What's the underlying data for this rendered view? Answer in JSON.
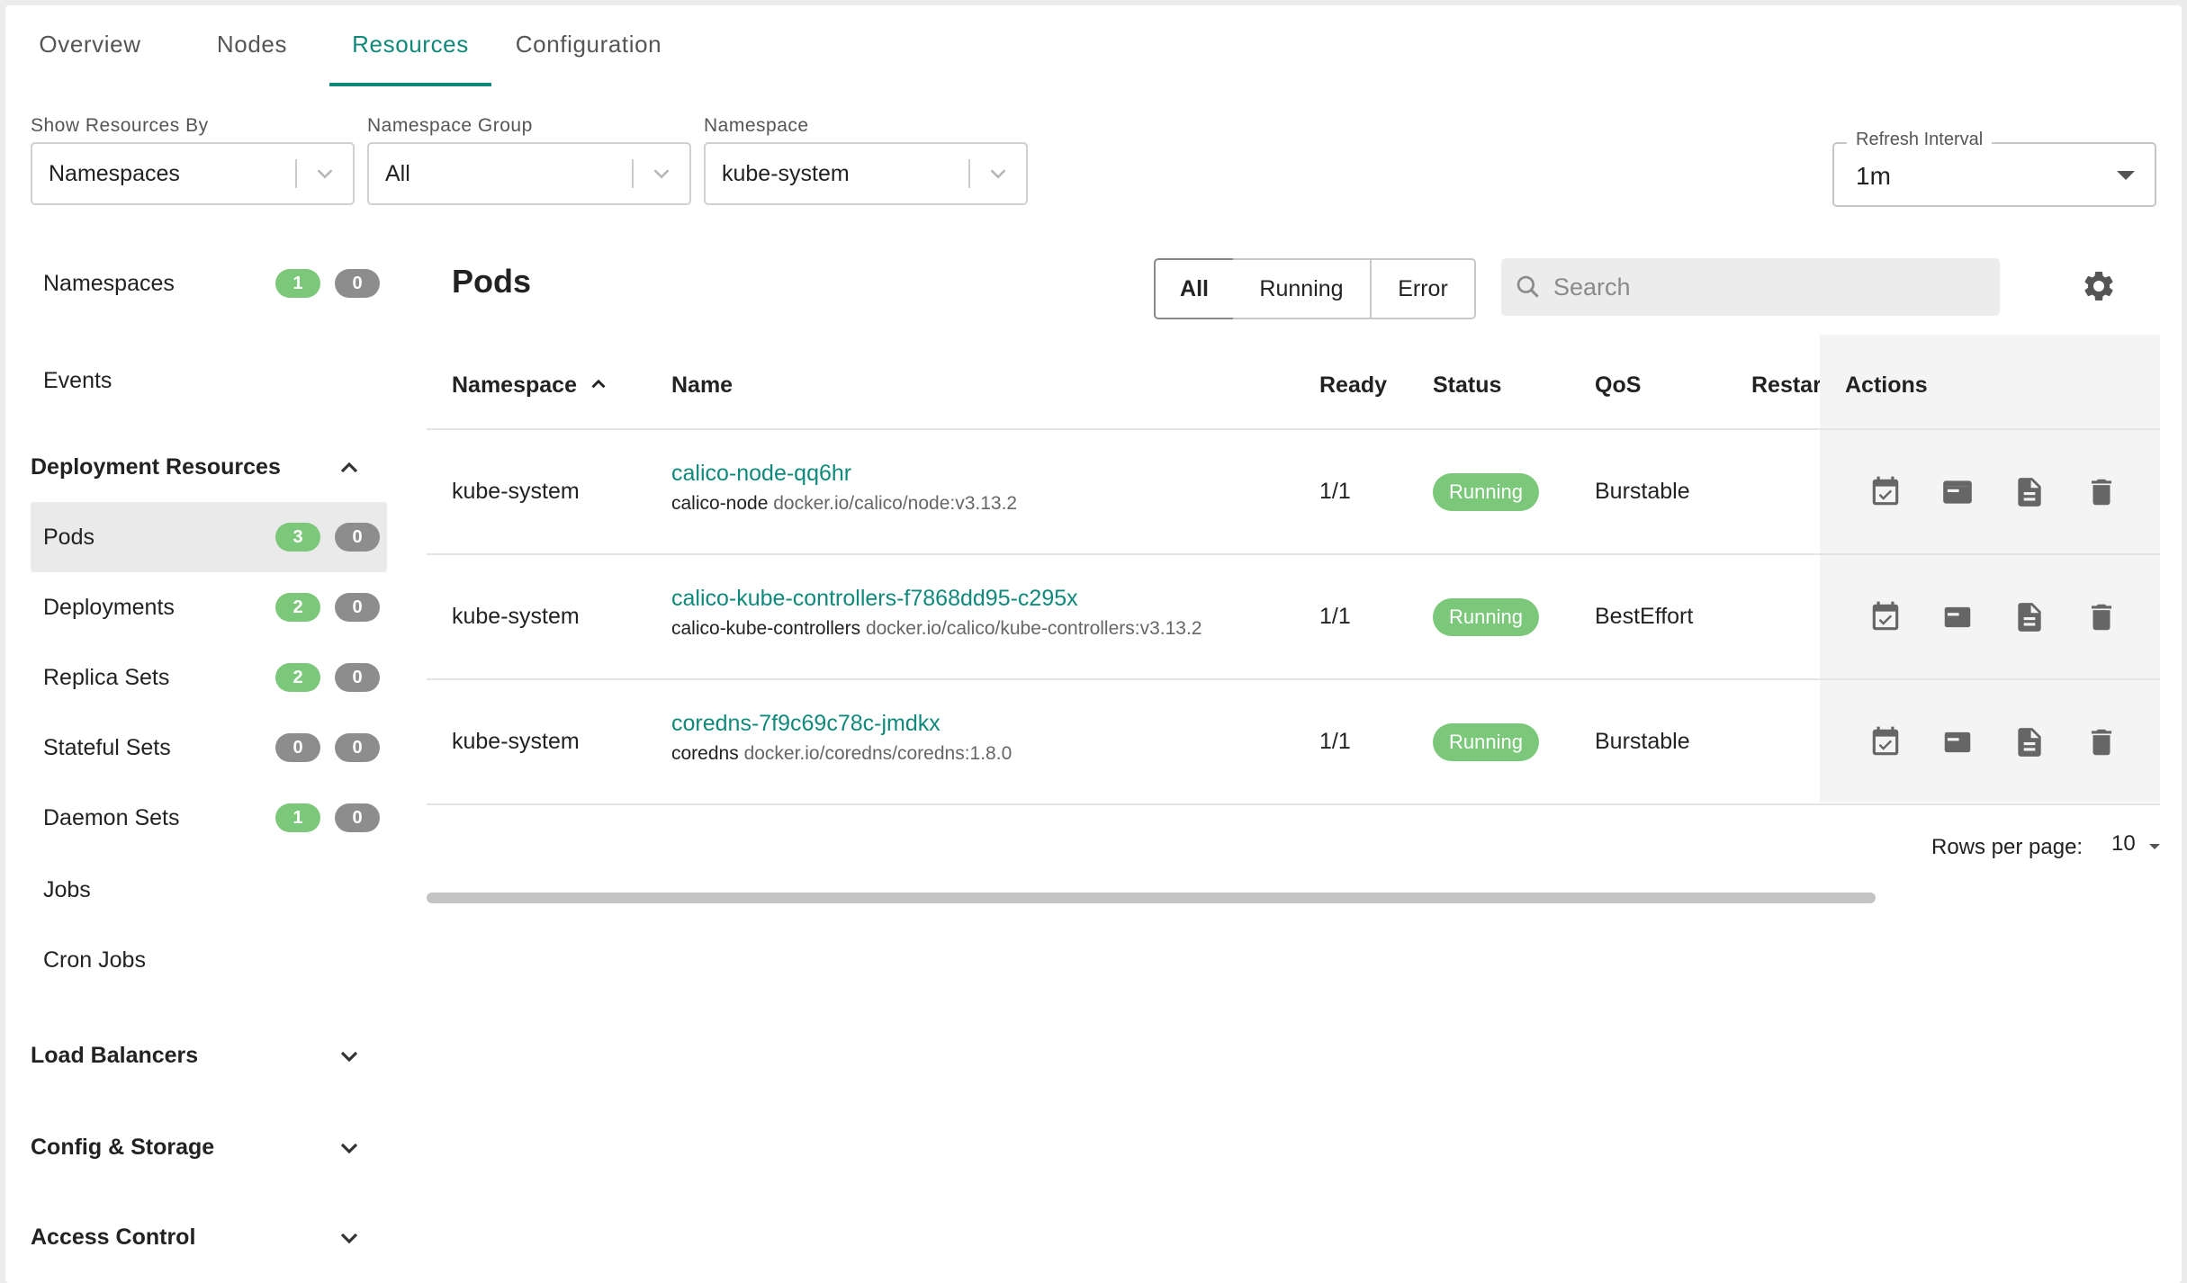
{
  "tabs": [
    {
      "label": "Overview"
    },
    {
      "label": "Nodes"
    },
    {
      "label": "Resources",
      "active": true
    },
    {
      "label": "Configuration"
    }
  ],
  "filters": {
    "show_by": {
      "label": "Show Resources By",
      "value": "Namespaces"
    },
    "namespace_group": {
      "label": "Namespace Group",
      "value": "All"
    },
    "namespace": {
      "label": "Namespace",
      "value": "kube-system"
    },
    "refresh": {
      "label": "Refresh Interval",
      "value": "1m"
    }
  },
  "sidebar": {
    "namespaces": {
      "label": "Namespaces",
      "ok": "1",
      "err": "0"
    },
    "events": {
      "label": "Events"
    },
    "deployment_resources": {
      "label": "Deployment Resources",
      "items": [
        {
          "label": "Pods",
          "ok": "3",
          "err": "0"
        },
        {
          "label": "Deployments",
          "ok": "2",
          "err": "0"
        },
        {
          "label": "Replica Sets",
          "ok": "2",
          "err": "0"
        },
        {
          "label": "Stateful Sets",
          "ok": "0",
          "err": "0"
        },
        {
          "label": "Daemon Sets",
          "ok": "1",
          "err": "0"
        },
        {
          "label": "Jobs"
        },
        {
          "label": "Cron Jobs"
        }
      ]
    },
    "groups": [
      {
        "label": "Load Balancers"
      },
      {
        "label": "Config & Storage"
      },
      {
        "label": "Access Control"
      }
    ]
  },
  "pods": {
    "title": "Pods",
    "filter_all": "All",
    "filter_running": "Running",
    "filter_error": "Error",
    "search_placeholder": "Search",
    "columns": {
      "namespace": "Namespace",
      "name": "Name",
      "ready": "Ready",
      "status": "Status",
      "qos": "QoS",
      "restarts": "Restart",
      "actions": "Actions"
    },
    "rows": [
      {
        "namespace": "kube-system",
        "name": "calico-node-qq6hr",
        "container": "calico-node",
        "image": "docker.io/calico/node:v3.13.2",
        "ready": "1/1",
        "status": "Running",
        "qos": "Burstable"
      },
      {
        "namespace": "kube-system",
        "name": "calico-kube-controllers-f7868dd95-c295x",
        "container": "calico-kube-controllers",
        "image": "docker.io/calico/kube-controllers:v3.13.2",
        "ready": "1/1",
        "status": "Running",
        "qos": "BestEffort"
      },
      {
        "namespace": "kube-system",
        "name": "coredns-7f9c69c78c-jmdkx",
        "container": "coredns",
        "image": "docker.io/coredns/coredns:1.8.0",
        "ready": "1/1",
        "status": "Running",
        "qos": "Burstable"
      }
    ],
    "rows_per_page_label": "Rows per page:",
    "rows_per_page": "10"
  },
  "colors": {
    "accent": "#10897b",
    "ok": "#7cc87a",
    "err": "#8d8d8d"
  }
}
